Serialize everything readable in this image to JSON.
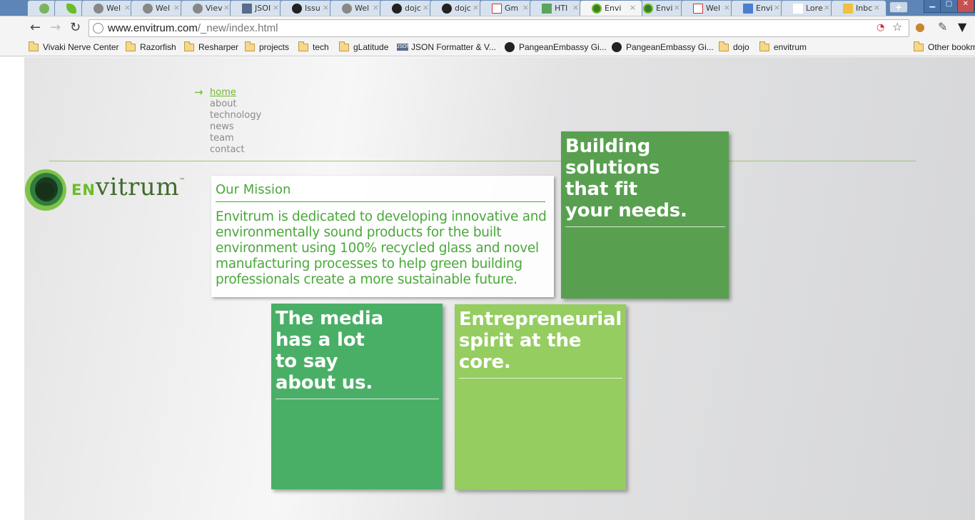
{
  "browser": {
    "tabs": [
      {
        "label": ""
      },
      {
        "label": ""
      },
      {
        "label": "Wel"
      },
      {
        "label": "Wel"
      },
      {
        "label": "Viev"
      },
      {
        "label": "JSOI"
      },
      {
        "label": "Issu"
      },
      {
        "label": "Wel"
      },
      {
        "label": "dojc"
      },
      {
        "label": "dojc"
      },
      {
        "label": "Gm"
      },
      {
        "label": "HTI"
      },
      {
        "label": "Envi"
      },
      {
        "label": "Envi"
      },
      {
        "label": "Wel"
      },
      {
        "label": "Envi"
      },
      {
        "label": "Lore"
      },
      {
        "label": "Inbc"
      }
    ],
    "active_tab_index": 12,
    "url": {
      "host": "www.envitrum.com",
      "path": "/_new/index.html"
    },
    "bookmarks": [
      {
        "label": "Vivaki Nerve Center",
        "icon": "folder-icon"
      },
      {
        "label": "Razorfish",
        "icon": "folder-icon"
      },
      {
        "label": "Resharper",
        "icon": "folder-icon"
      },
      {
        "label": "projects",
        "icon": "folder-icon"
      },
      {
        "label": "tech",
        "icon": "folder-icon"
      },
      {
        "label": "gLatitude",
        "icon": "folder-icon"
      },
      {
        "label": "JSON Formatter & V...",
        "icon": "json-icon"
      },
      {
        "label": "PangeanEmbassy Gi...",
        "icon": "github-icon"
      },
      {
        "label": "PangeanEmbassy Gi...",
        "icon": "github-icon"
      },
      {
        "label": "dojo",
        "icon": "folder-icon"
      },
      {
        "label": "envitrum",
        "icon": "folder-icon"
      }
    ],
    "other_bookmarks": "Other bookm"
  },
  "site": {
    "nav": [
      {
        "label": "home"
      },
      {
        "label": "about"
      },
      {
        "label": "technology"
      },
      {
        "label": "news"
      },
      {
        "label": "team"
      },
      {
        "label": "contact"
      }
    ],
    "logo": {
      "prefix": "EN",
      "name": "vitrum",
      "tm": "™"
    },
    "mission": {
      "title": "Our Mission",
      "text": "Envitrum is dedicated to developing innovative and environmentally sound products for the built environment using 100% recycled glass and novel manufacturing processes to help green building professionals create a more sustainable future."
    },
    "cards": [
      {
        "headline": "Building\nsolutions\nthat fit\nyour needs."
      },
      {
        "headline": "The media\nhas a lot\nto say\nabout us."
      },
      {
        "headline": "Entrepreneurial\nspirit at the\ncore."
      }
    ],
    "colors": {
      "accent_green": "#6cbc2a",
      "text_green": "#4aa83a",
      "card_dark_green": "#58a050",
      "card_mid_green": "#4aaf66",
      "card_light_green": "#95cd60"
    }
  }
}
